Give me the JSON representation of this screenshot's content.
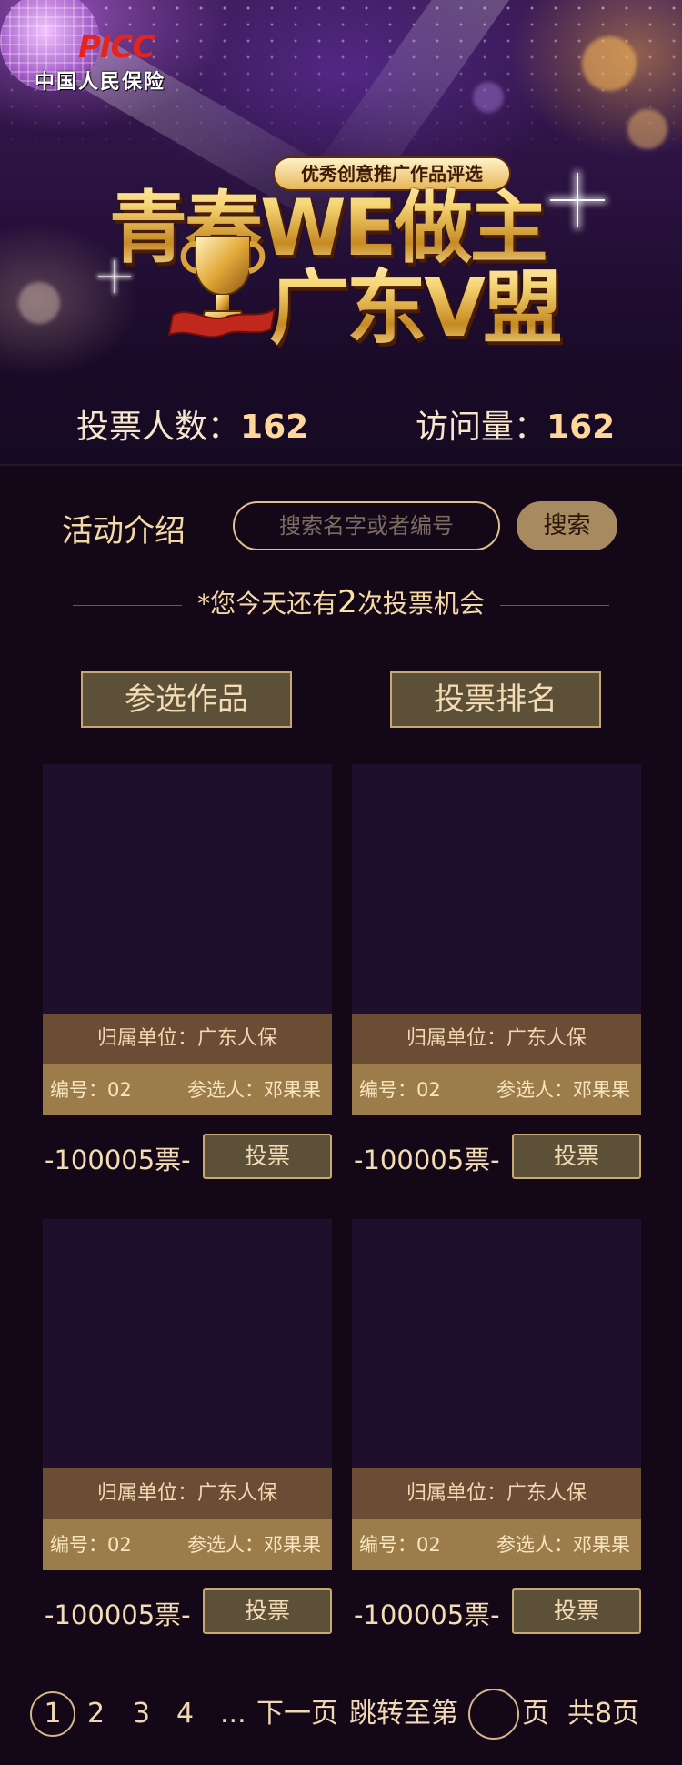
{
  "brand": {
    "logo_mark": "PICC",
    "logo_cn": "中国人民保险"
  },
  "banner": {
    "slogan": "优秀创意推广作品评选",
    "title_line1": "青春WE做主",
    "title_line2": "广东V盟"
  },
  "stats": {
    "voters_label": "投票人数：",
    "voters_value": "162",
    "visits_label": "访问量：",
    "visits_value": "162"
  },
  "controls": {
    "intro_label": "活动介绍",
    "search_placeholder": "搜索名字或者编号",
    "search_button": "搜索",
    "chance_prefix": "*您今天还有",
    "chance_count": "2",
    "chance_suffix": "次投票机会"
  },
  "tabs": [
    {
      "label": "参选作品"
    },
    {
      "label": "投票排名"
    }
  ],
  "cards": [
    {
      "unit": "归属单位：广东人保",
      "number": "编号：02",
      "entrant": "参选人：邓果果",
      "votes": "-100005票-",
      "vote_button": "投票"
    },
    {
      "unit": "归属单位：广东人保",
      "number": "编号：02",
      "entrant": "参选人：邓果果",
      "votes": "-100005票-",
      "vote_button": "投票"
    },
    {
      "unit": "归属单位：广东人保",
      "number": "编号：02",
      "entrant": "参选人：邓果果",
      "votes": "-100005票-",
      "vote_button": "投票"
    },
    {
      "unit": "归属单位：广东人保",
      "number": "编号：02",
      "entrant": "参选人：邓果果",
      "votes": "-100005票-",
      "vote_button": "投票"
    }
  ],
  "pagination": {
    "current": "1",
    "pages": [
      "2",
      "3",
      "4"
    ],
    "ellipsis": "...",
    "next": "下一页",
    "jump_label": "跳转至第",
    "page_unit": "页",
    "total": "共8页"
  },
  "colors": {
    "background": "#140818",
    "accent_gold": "#c8a872",
    "button_fill": "#5c5038",
    "card_unit_bar": "#6b4c34",
    "card_meta_bar": "#9c7c4a"
  }
}
